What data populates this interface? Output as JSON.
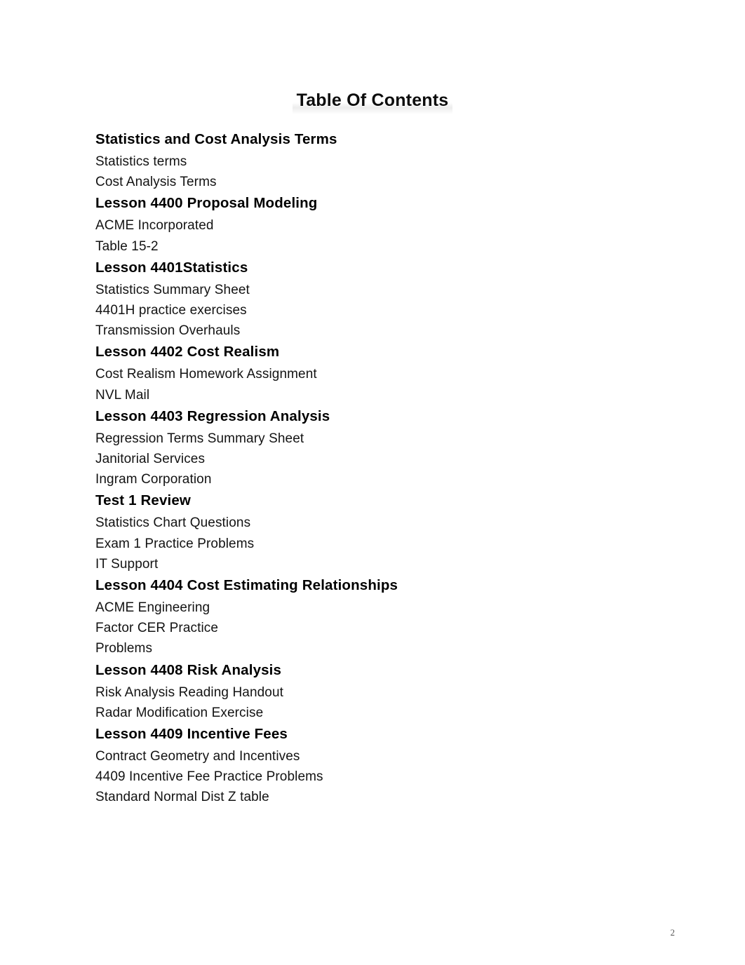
{
  "document": {
    "title": "Table Of Contents",
    "page_number": "2"
  },
  "toc": {
    "sections": [
      {
        "heading": "Statistics and Cost Analysis Terms",
        "entries": [
          "Statistics terms",
          "Cost Analysis Terms"
        ]
      },
      {
        "heading": "Lesson 4400 Proposal Modeling",
        "entries": [
          "ACME Incorporated",
          "Table 15-2"
        ]
      },
      {
        "heading": "Lesson 4401Statistics",
        "entries": [
          "Statistics Summary Sheet",
          "4401H practice exercises",
          "Transmission Overhauls"
        ]
      },
      {
        "heading": "Lesson 4402 Cost Realism",
        "entries": [
          "Cost Realism Homework Assignment",
          "NVL Mail"
        ]
      },
      {
        "heading": "Lesson 4403 Regression Analysis",
        "entries": [
          "Regression Terms Summary Sheet",
          "Janitorial Services",
          "Ingram Corporation"
        ]
      },
      {
        "heading": "Test 1 Review",
        "entries": [
          "Statistics Chart Questions",
          "Exam 1 Practice Problems",
          "IT Support"
        ]
      },
      {
        "heading": "Lesson 4404 Cost Estimating Relationships",
        "entries": [
          "ACME Engineering",
          "Factor CER Practice",
          "Problems"
        ]
      },
      {
        "heading": "Lesson 4408 Risk Analysis",
        "entries": [
          "Risk Analysis Reading Handout",
          "Radar Modification Exercise"
        ]
      },
      {
        "heading": "Lesson 4409 Incentive Fees",
        "entries": [
          "Contract Geometry and Incentives",
          "4409 Incentive Fee Practice Problems",
          "Standard Normal Dist Z table"
        ]
      }
    ]
  }
}
